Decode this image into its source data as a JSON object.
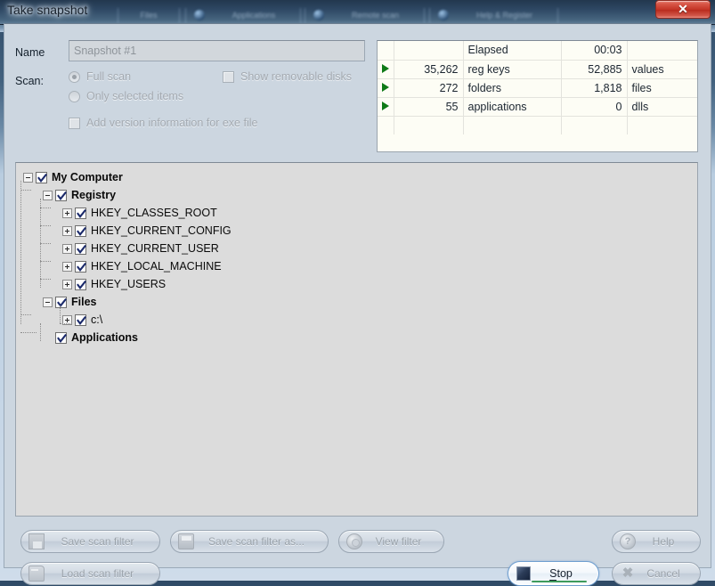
{
  "window": {
    "title": "Take snapshot",
    "close_label": "✕"
  },
  "background_tabs": [
    {
      "label": "Files"
    },
    {
      "label": "Applications"
    },
    {
      "label": "Remote scan"
    },
    {
      "label": "Help & Register"
    }
  ],
  "form": {
    "name_label": "Name",
    "name_value": "Snapshot #1",
    "name_placeholder": "Snapshot #1",
    "scan_label": "Scan:",
    "radio_full_scan": "Full scan",
    "radio_only_selected": "Only selected items",
    "check_show_removable": "Show removable disks",
    "check_add_version": "Add version information for exe file"
  },
  "stats": {
    "rows": [
      {
        "arrow": false,
        "num1": "",
        "label1": "Elapsed",
        "num2": "00:03",
        "label2": ""
      },
      {
        "arrow": true,
        "num1": "35,262",
        "label1": "reg keys",
        "num2": "52,885",
        "label2": "values"
      },
      {
        "arrow": true,
        "num1": "272",
        "label1": "folders",
        "num2": "1,818",
        "label2": "files"
      },
      {
        "arrow": true,
        "num1": "55",
        "label1": "applications",
        "num2": "0",
        "label2": "dlls"
      },
      {
        "arrow": false,
        "num1": "",
        "label1": "",
        "num2": "",
        "label2": ""
      }
    ]
  },
  "tree": {
    "items": [
      {
        "label": "My Computer",
        "depth": 0,
        "expander": "minus",
        "checked": true,
        "bold": true
      },
      {
        "label": "Registry",
        "depth": 1,
        "expander": "minus",
        "checked": true,
        "bold": true
      },
      {
        "label": "HKEY_CLASSES_ROOT",
        "depth": 2,
        "expander": "plus",
        "checked": true,
        "bold": false
      },
      {
        "label": "HKEY_CURRENT_CONFIG",
        "depth": 2,
        "expander": "plus",
        "checked": true,
        "bold": false
      },
      {
        "label": "HKEY_CURRENT_USER",
        "depth": 2,
        "expander": "plus",
        "checked": true,
        "bold": false
      },
      {
        "label": "HKEY_LOCAL_MACHINE",
        "depth": 2,
        "expander": "plus",
        "checked": true,
        "bold": false
      },
      {
        "label": "HKEY_USERS",
        "depth": 2,
        "expander": "plus",
        "checked": true,
        "bold": false
      },
      {
        "label": "Files",
        "depth": 1,
        "expander": "minus",
        "checked": true,
        "bold": true
      },
      {
        "label": "c:\\",
        "depth": 2,
        "expander": "plus",
        "checked": true,
        "bold": false
      },
      {
        "label": "Applications",
        "depth": 1,
        "expander": "none",
        "checked": true,
        "bold": true
      }
    ]
  },
  "buttons": {
    "save_scan_filter": "Save scan filter",
    "save_scan_filter_as": "Save scan filter as...",
    "view_filter": "View filter",
    "load_scan_filter": "Load scan filter",
    "help": "Help",
    "cancel": "Cancel",
    "stop": "Stop"
  },
  "colors": {
    "dialog_bg": "#ccd6e0",
    "tree_bg": "#dcdcdc",
    "stats_bg": "#fdfdf5",
    "close_red": "#c33426",
    "arrow_green": "#0e7a17",
    "check_navy": "#1b2a6b",
    "stop_accent": "#3f9b5c"
  }
}
